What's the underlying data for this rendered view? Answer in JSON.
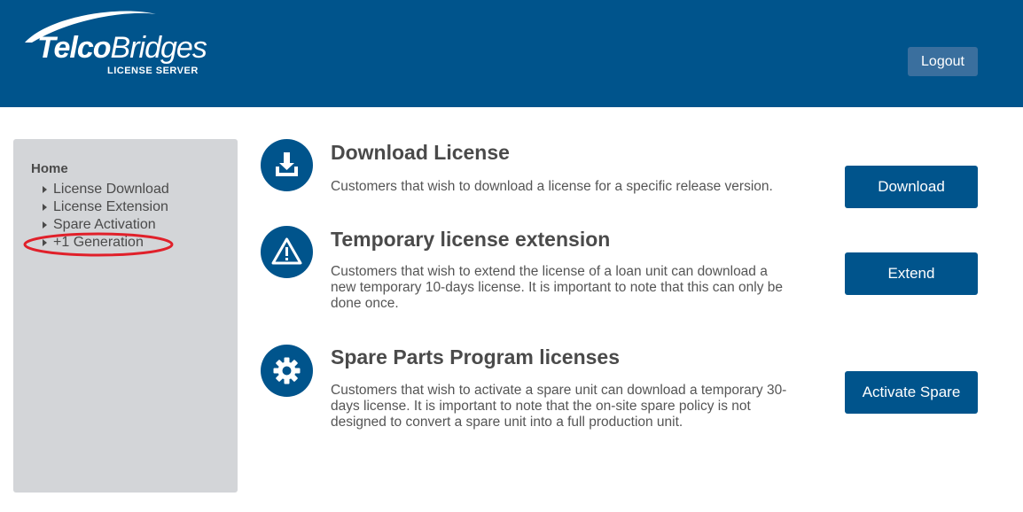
{
  "header": {
    "logo_main": "Telco",
    "logo_second": "Bridges",
    "logo_sub": "LICENSE SERVER",
    "logout_label": "Logout",
    "bg_color": "#00548c"
  },
  "sidebar": {
    "home_label": "Home",
    "items": [
      {
        "label": "License Download"
      },
      {
        "label": "License Extension"
      },
      {
        "label": "Spare Activation"
      },
      {
        "label": "+1 Generation"
      }
    ],
    "highlighted_item": "+1 Generation",
    "highlight_color": "#e0202a"
  },
  "main": {
    "rows": [
      {
        "icon": "download-icon",
        "title": "Download License",
        "description": "Customers that wish to download a license for a specific release version.",
        "button_label": "Download"
      },
      {
        "icon": "warning-icon",
        "title": "Temporary license extension",
        "description": "Customers that wish to extend the license of a loan unit can download a new temporary 10-days license. It is important to note that this can only be done once.",
        "button_label": "Extend"
      },
      {
        "icon": "gear-icon",
        "title": "Spare Parts Program licenses",
        "description": "Customers that wish to activate a spare unit can download a temporary 30-days license. It is important to note that the on-site spare policy is not designed to convert a spare unit into a full production unit.",
        "button_label": "Activate Spare"
      }
    ]
  }
}
